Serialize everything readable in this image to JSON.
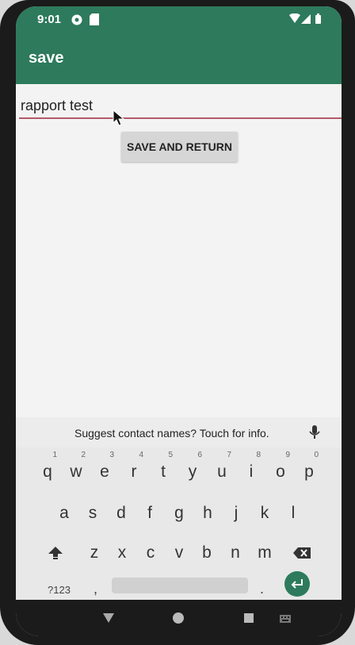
{
  "status_bar": {
    "time": "9:01"
  },
  "app_bar": {
    "title": "save"
  },
  "form": {
    "text_value": "rapport test",
    "button_label": "SAVE AND RETURN"
  },
  "keyboard": {
    "suggestion": "Suggest contact names? Touch for info.",
    "row1": [
      "q",
      "w",
      "e",
      "r",
      "t",
      "y",
      "u",
      "i",
      "o",
      "p"
    ],
    "row1_hints": [
      "1",
      "2",
      "3",
      "4",
      "5",
      "6",
      "7",
      "8",
      "9",
      "0"
    ],
    "row2": [
      "a",
      "s",
      "d",
      "f",
      "g",
      "h",
      "j",
      "k",
      "l"
    ],
    "row3": [
      "z",
      "x",
      "c",
      "v",
      "b",
      "n",
      "m"
    ],
    "symbols_key": "?123",
    "comma": ",",
    "period": "."
  },
  "colors": {
    "app_bar": "#2d7b5c",
    "status_bar": "#2e7a5d",
    "underline": "#b45a6a",
    "button": "#d6d6d6"
  }
}
